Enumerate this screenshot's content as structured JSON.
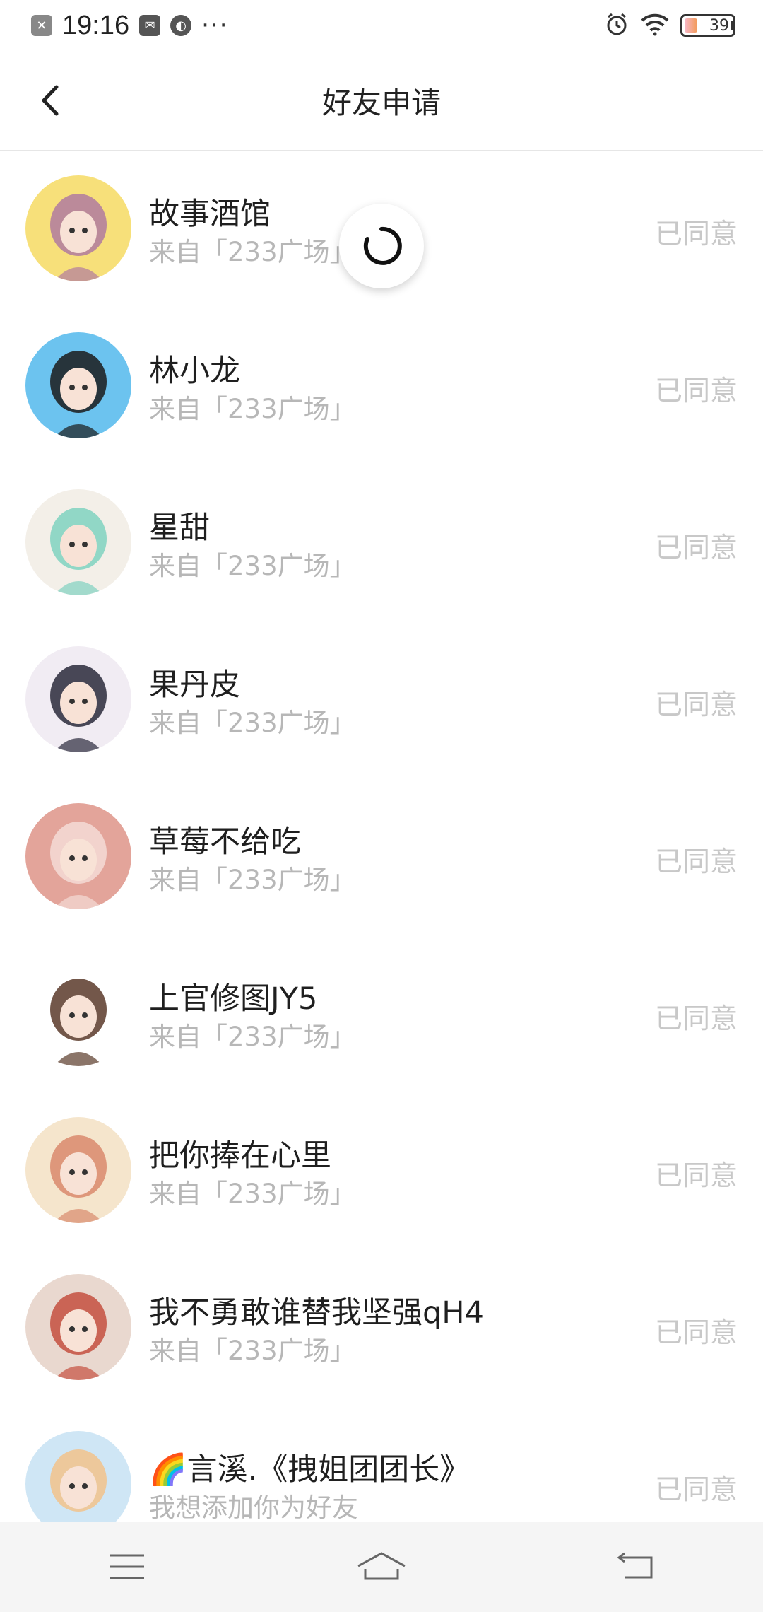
{
  "status_bar": {
    "time": "19:16",
    "more": "···",
    "battery": "39",
    "icons": [
      "close-box-icon",
      "message-icon",
      "planet-icon",
      "alarm-icon",
      "wifi-icon",
      "battery-icon"
    ]
  },
  "header": {
    "title": "好友申请",
    "back_icon": "chevron-left-icon"
  },
  "requests": [
    {
      "name": "故事酒馆",
      "source": "来自「233广场」",
      "status": "已同意",
      "avatar_colors": [
        "#f7e07a",
        "#b07aa0"
      ]
    },
    {
      "name": "林小龙",
      "source": "来自「233广场」",
      "status": "已同意",
      "avatar_colors": [
        "#6cc3ef",
        "#1b1b1b"
      ]
    },
    {
      "name": "星甜",
      "source": "来自「233广场」",
      "status": "已同意",
      "avatar_colors": [
        "#f3efe8",
        "#7fd2c0"
      ]
    },
    {
      "name": "果丹皮",
      "source": "来自「233广场」",
      "status": "已同意",
      "avatar_colors": [
        "#f1ecf3",
        "#2a2a3a"
      ]
    },
    {
      "name": "草莓不给吃",
      "source": "来自「233广场」",
      "status": "已同意",
      "avatar_colors": [
        "#e3a49a",
        "#f4dcd6"
      ]
    },
    {
      "name": "上官修图JY5",
      "source": "来自「233广场」",
      "status": "已同意",
      "avatar_colors": [
        "#ffffff",
        "#5a3a2a"
      ]
    },
    {
      "name": "把你捧在心里",
      "source": "来自「233广场」",
      "status": "已同意",
      "avatar_colors": [
        "#f5e5cc",
        "#d98a6c"
      ]
    },
    {
      "name": "我不勇敢谁替我坚强qH4",
      "source": "来自「233广场」",
      "status": "已同意",
      "avatar_colors": [
        "#e9d8cf",
        "#c4503f"
      ]
    },
    {
      "name": "🌈言溪.《拽姐团团长》",
      "source": "我想添加你为好友",
      "status": "已同意",
      "avatar_colors": [
        "#cfe6f5",
        "#f2c28b"
      ]
    }
  ],
  "nav": {
    "icons": [
      "menu-icon",
      "home-icon",
      "back-icon"
    ]
  },
  "colors": {
    "text_primary": "#1f1f1f",
    "text_secondary": "#b7b7b7",
    "status_text": "#c8c8c8"
  }
}
